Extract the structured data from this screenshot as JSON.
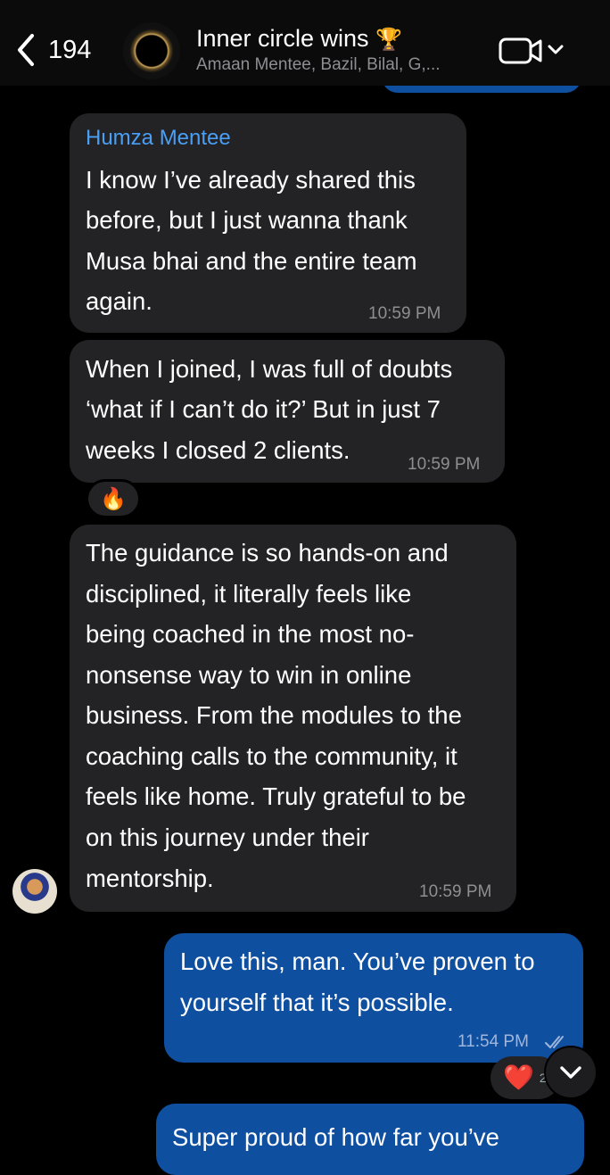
{
  "header": {
    "back_count": "194",
    "title": "Inner circle wins",
    "trophy": "🏆",
    "subtitle": "Amaan Mentee, Bazil, Bilal, G,...",
    "video_icon": "video-camera-icon",
    "chevron_icon": "chevron-down-icon"
  },
  "messages": [
    {
      "sender": "Humza Mentee",
      "lines": [
        "I know I’ve already shared this",
        "before, but I just wanna thank",
        "Musa bhai and the entire team",
        "again."
      ],
      "time": "10:59 PM"
    },
    {
      "lines": [
        "When I joined, I was full of doubts",
        "‘what if I can’t do it?’ But in just 7",
        "weeks I closed 2 clients."
      ],
      "time": "10:59 PM",
      "reaction": "🔥"
    },
    {
      "lines": [
        "The guidance is so hands-on and",
        "disciplined, it literally feels like",
        "being coached in the most no-",
        "nonsense way to win in online",
        "business. From the modules to the",
        "coaching calls to the community, it",
        "feels like home. Truly grateful to be",
        "on this journey under their",
        "mentorship."
      ],
      "time": "10:59 PM"
    },
    {
      "lines": [
        "Love this, man. You’ve proven to",
        "yourself that it’s possible."
      ],
      "time": "11:54 PM",
      "reaction": "❤️",
      "reaction_count": "2"
    },
    {
      "lines": [
        "Super proud of how far you’ve"
      ]
    }
  ],
  "colors": {
    "background": "#000000",
    "incoming_bubble": "#232325",
    "outgoing_bubble": "#0f4fa0",
    "sender_name": "#4a9ff5",
    "timestamp": "#8e8e93"
  }
}
